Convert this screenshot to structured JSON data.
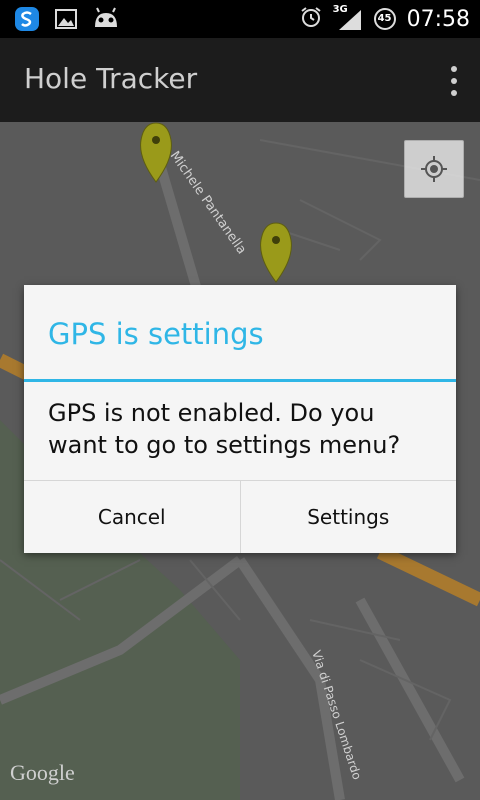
{
  "status_bar": {
    "time": "07:58",
    "network": "3G",
    "battery_level": "45",
    "icons": [
      "s-app-icon",
      "image-icon",
      "android-icon",
      "alarm-icon",
      "signal-icon",
      "battery-icon"
    ]
  },
  "action_bar": {
    "title": "Hole Tracker",
    "overflow_icon": "overflow-menu-icon"
  },
  "map": {
    "streets": [
      "Michele Pantanella",
      "Via di Passo Lombardo"
    ],
    "logo": "Google",
    "markers": 2,
    "my_location_icon": "my-location-icon"
  },
  "dialog": {
    "title": "GPS is settings",
    "message": "GPS is not enabled. Do you want to go to settings menu?",
    "cancel_label": "Cancel",
    "settings_label": "Settings",
    "accent_color": "#2fb6e6"
  }
}
